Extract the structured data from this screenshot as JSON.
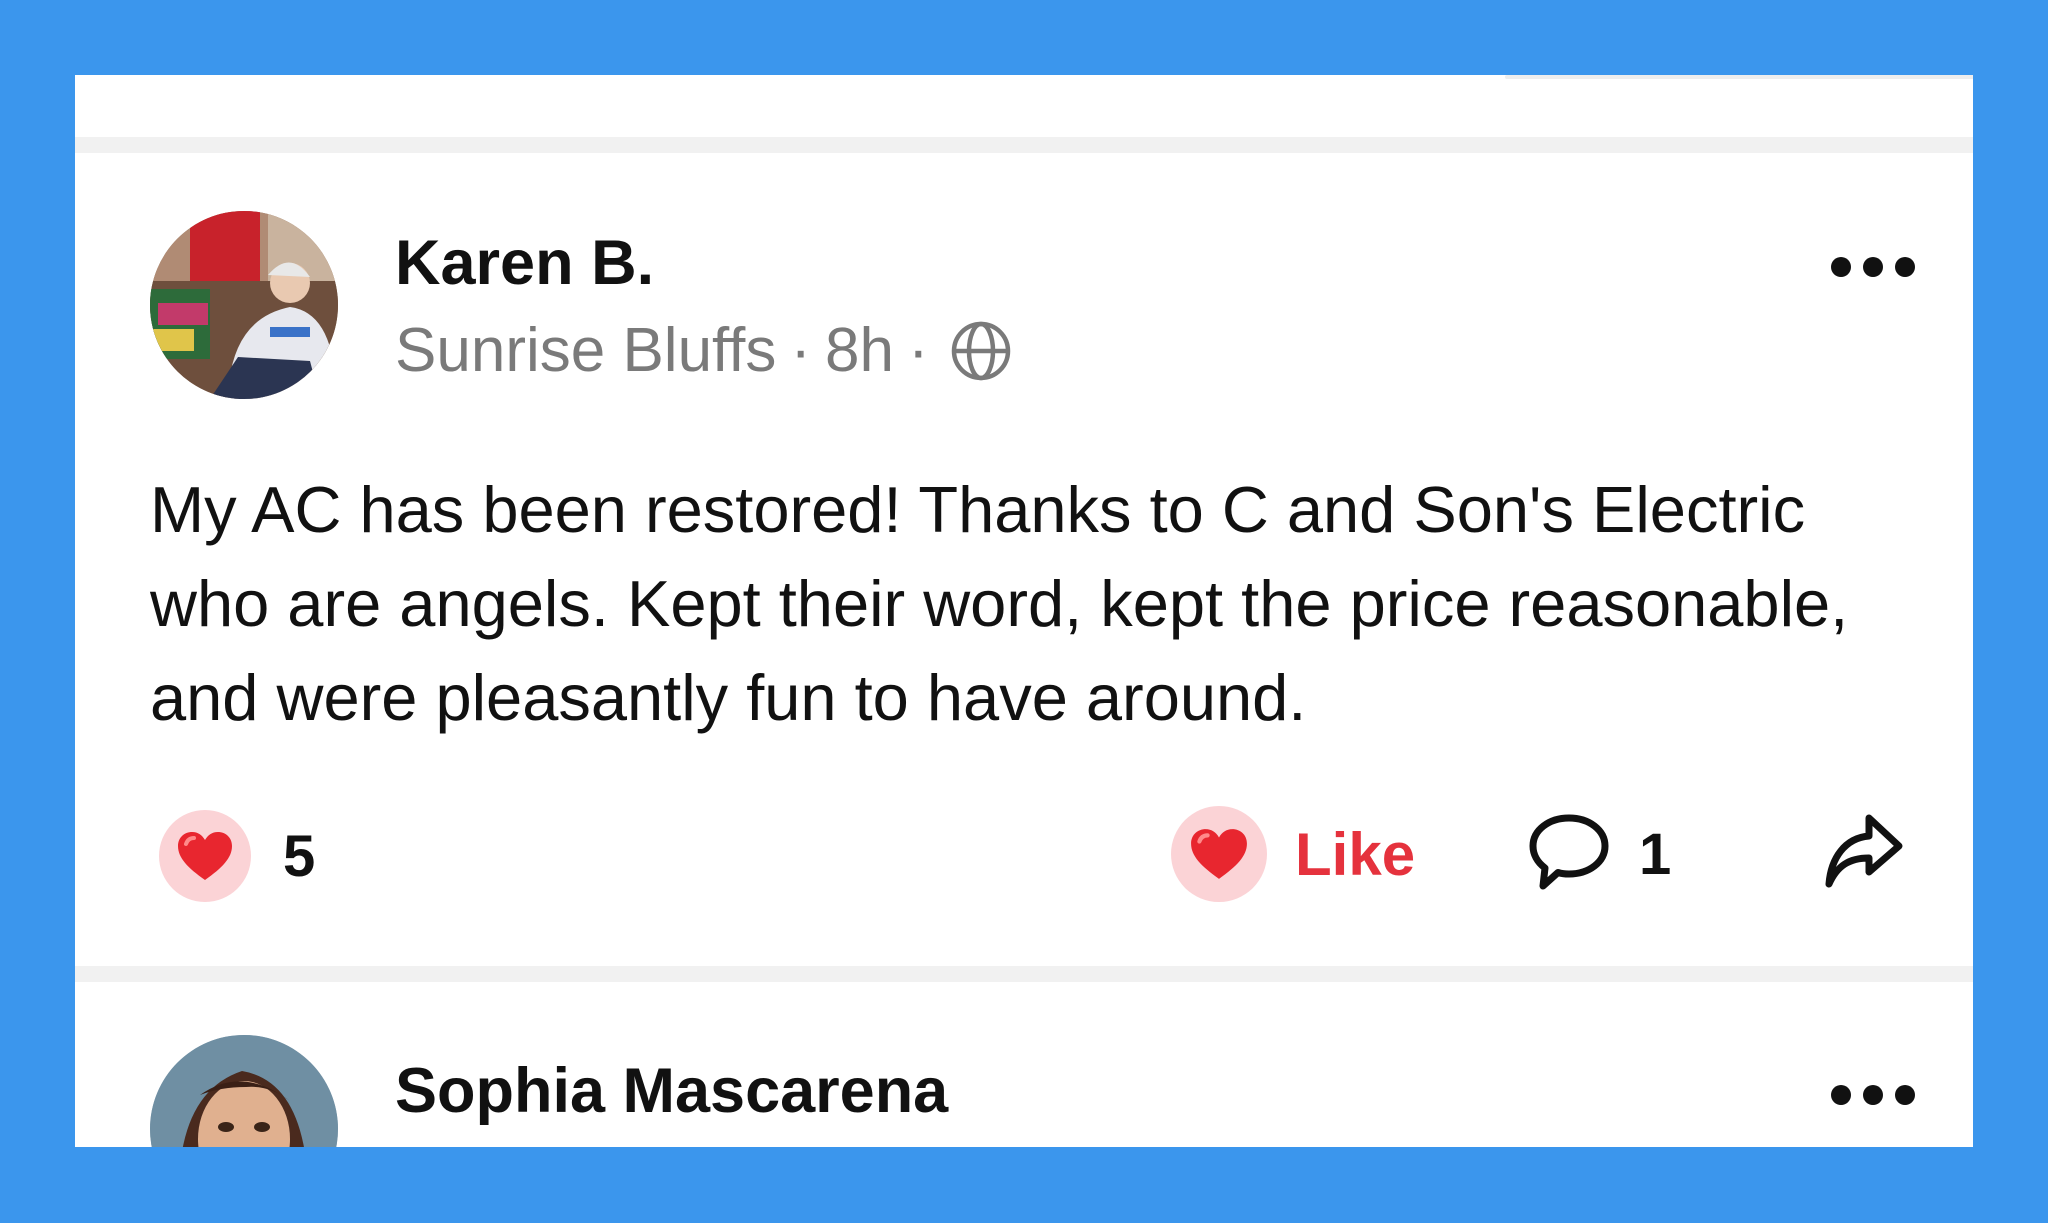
{
  "posts": [
    {
      "author": "Karen B.",
      "neighborhood": "Sunrise Bluffs",
      "separator": "·",
      "time": "8h",
      "visibility_icon": "globe-icon",
      "text": "My AC has been restored! Thanks to C and Son's Electric who are angels. Kept their word, kept the price reasonable, and were pleasantly fun to have around.",
      "reaction_icon": "heart-icon",
      "reaction_count": "5",
      "like_label": "Like",
      "comment_count": "1",
      "comment_icon": "speech-bubble-icon",
      "share_icon": "share-arrow-icon",
      "more_icon": "more-options-icon"
    },
    {
      "author": "Sophia Mascarena",
      "more_icon": "more-options-icon"
    }
  ],
  "colors": {
    "background": "#3b96ed",
    "card": "#ffffff",
    "like_accent": "#e5323d",
    "heart": "#e8262f",
    "heart_bubble": "#fbd3d6",
    "meta_text": "#7a7a7a"
  }
}
